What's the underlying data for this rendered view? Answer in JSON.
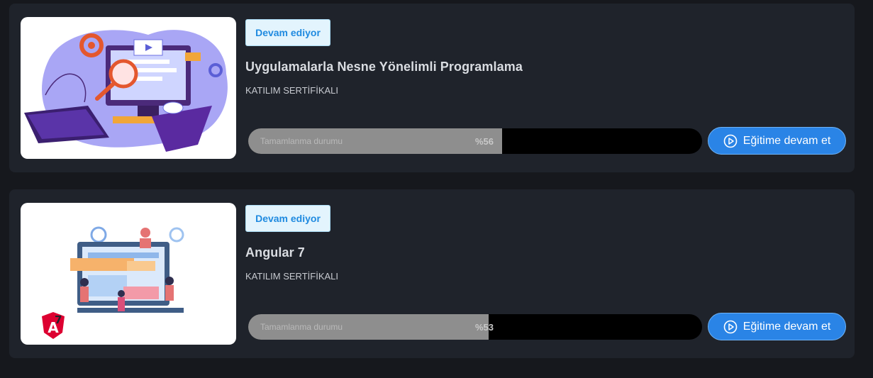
{
  "courses": [
    {
      "status": "Devam ediyor",
      "title": "Uygulamalarla Nesne Yönelimli Programlama",
      "certificate": "KATILIM SERTİFİKALI",
      "progress_label": "Tamamlanma durumu",
      "progress_text": "%56",
      "progress_fraction": 0.56,
      "button_label": "Eğitime devam et",
      "thumbnail_icon": "computer-illustration"
    },
    {
      "status": "Devam ediyor",
      "title": "Angular 7",
      "certificate": "KATILIM SERTİFİKALI",
      "progress_label": "Tamamlanma durumu",
      "progress_text": "%53",
      "progress_fraction": 0.53,
      "button_label": "Eğitime devam et",
      "thumbnail_icon": "angular-illustration",
      "thumbnail_badge": "7"
    }
  ],
  "colors": {
    "background": "#16181d",
    "card": "#1f232b",
    "badge_bg": "#e3f4fd",
    "badge_text": "#1f8ae0",
    "button": "#2a84e6",
    "progress_fill": "#8e8e8e",
    "progress_track": "#000000",
    "angular_red": "#dd0031"
  }
}
